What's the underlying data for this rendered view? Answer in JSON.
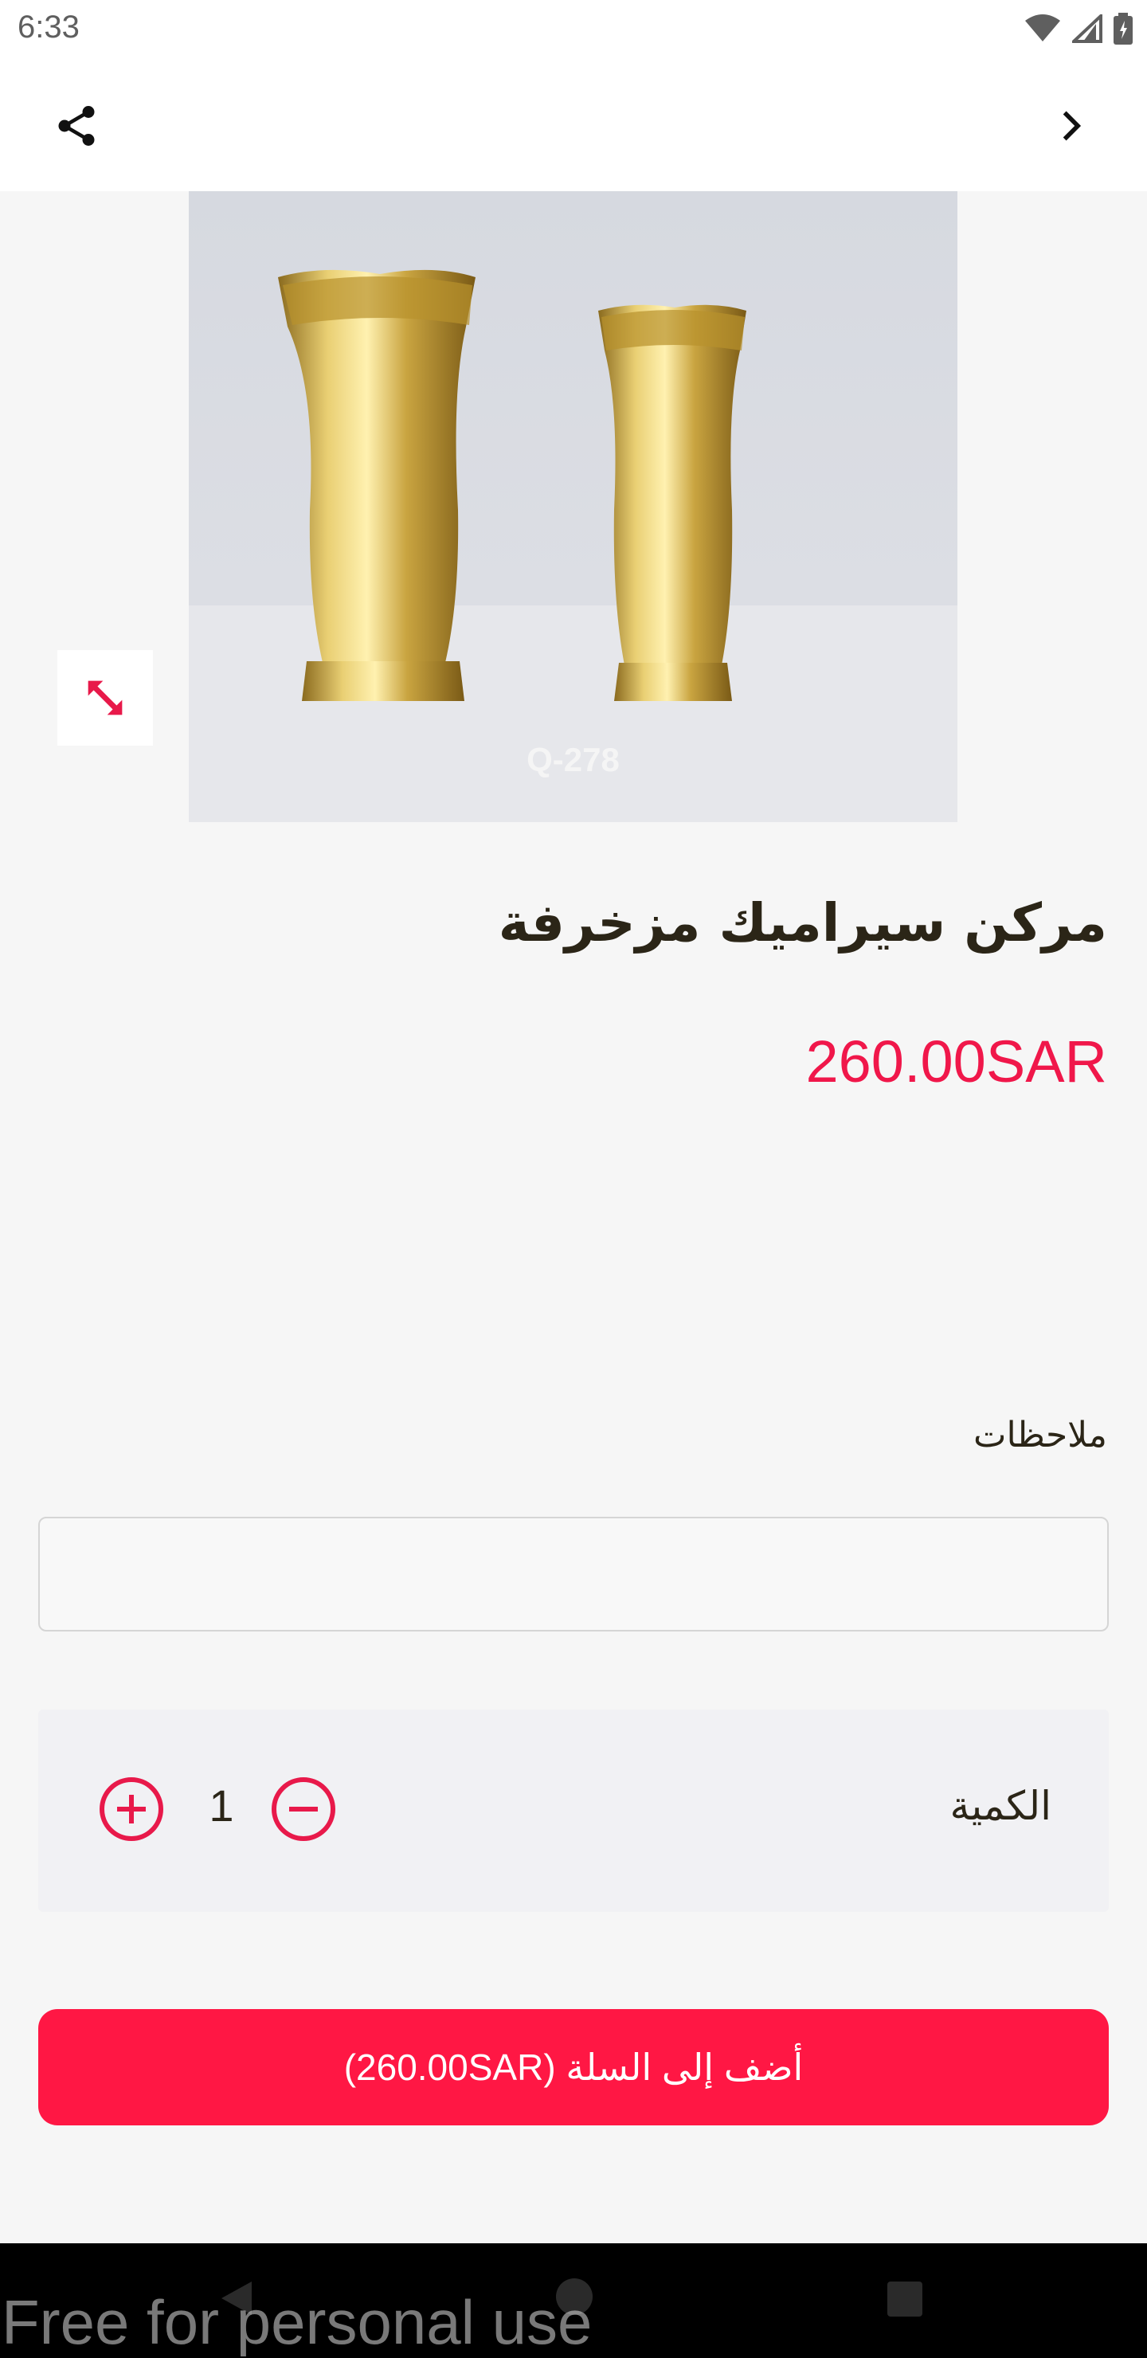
{
  "status_bar": {
    "time": "6:33"
  },
  "product": {
    "image_caption": "Q-278",
    "title": "مركن سيراميك مزخرفة",
    "price": "260.00SAR"
  },
  "notes": {
    "label": "ملاحظات",
    "value": ""
  },
  "quantity": {
    "label": "الكمية",
    "value": "1"
  },
  "add_to_cart": {
    "label": "أضف إلى السلة (260.00SAR)"
  },
  "watermark": "Free for personal use",
  "colors": {
    "accent": "#ff1744",
    "price": "#f0174a",
    "text": "#2b2517",
    "background": "#f6f6f6"
  },
  "icons": {
    "share": "share-icon",
    "back": "chevron-right-icon",
    "zoom": "expand-icon",
    "plus": "plus-circle-icon",
    "minus": "minus-circle-icon"
  }
}
